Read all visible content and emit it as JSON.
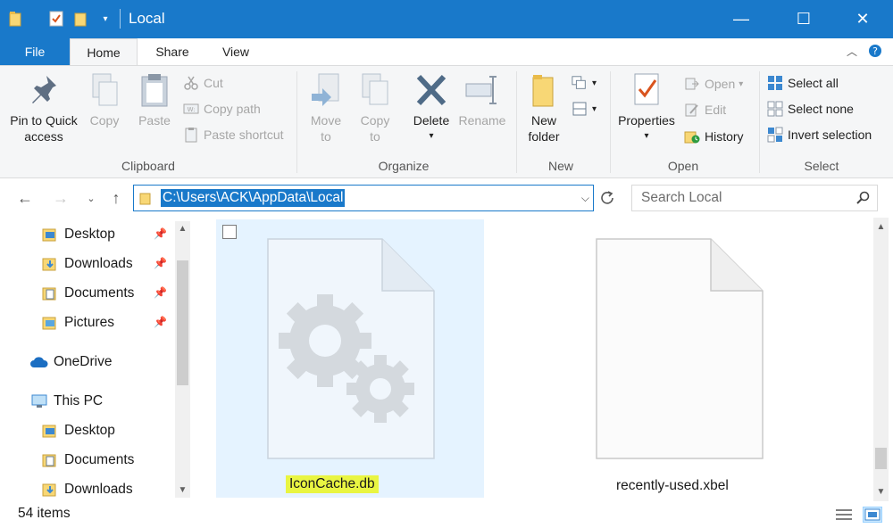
{
  "window": {
    "title": "Local",
    "controls": {
      "minimize": "—",
      "maximize": "☐",
      "close": "✕"
    }
  },
  "ribbon_tabs": {
    "file": "File",
    "home": "Home",
    "share": "Share",
    "view": "View"
  },
  "ribbon": {
    "clipboard": {
      "label": "Clipboard",
      "pin": "Pin to Quick access",
      "pin_line1": "Pin to Quick",
      "pin_line2": "access",
      "copy": "Copy",
      "paste": "Paste",
      "cut": "Cut",
      "copy_path": "Copy path",
      "paste_shortcut": "Paste shortcut"
    },
    "organize": {
      "label": "Organize",
      "move_to_1": "Move",
      "move_to_2": "to",
      "copy_to_1": "Copy",
      "copy_to_2": "to",
      "delete": "Delete",
      "rename": "Rename"
    },
    "new": {
      "label": "New",
      "new_folder_1": "New",
      "new_folder_2": "folder"
    },
    "open": {
      "label": "Open",
      "properties": "Properties",
      "open": "Open",
      "edit": "Edit",
      "history": "History"
    },
    "select": {
      "label": "Select",
      "select_all": "Select all",
      "select_none": "Select none",
      "invert": "Invert selection"
    }
  },
  "nav": {
    "address": "C:\\Users\\ACK\\AppData\\Local",
    "search_placeholder": "Search Local"
  },
  "sidebar": {
    "quick": [
      "Desktop",
      "Downloads",
      "Documents",
      "Pictures"
    ],
    "onedrive": "OneDrive",
    "thispc": "This PC",
    "pc": [
      "Desktop",
      "Documents",
      "Downloads"
    ]
  },
  "files": [
    {
      "name": "IconCache.db",
      "selected": true,
      "icon": "settings-file-icon"
    },
    {
      "name": "recently-used.xbel",
      "selected": false,
      "icon": "blank-file-icon"
    }
  ],
  "status": {
    "items": "54 items"
  },
  "colors": {
    "accent": "#1979ca",
    "selection": "#e5f3ff",
    "highlight": "#e9f542"
  }
}
